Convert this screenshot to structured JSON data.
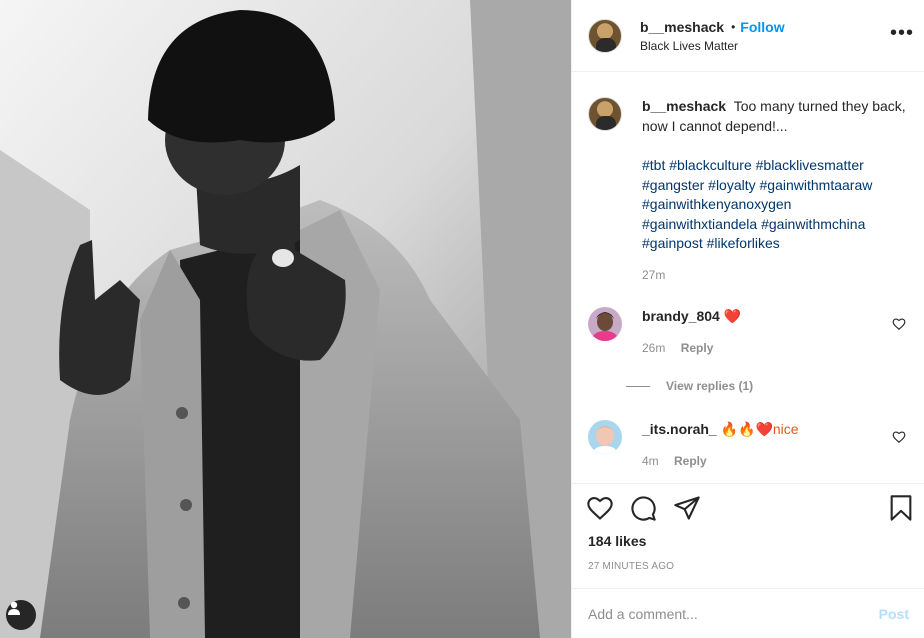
{
  "post": {
    "author": "b__meshack",
    "follow_separator": "•",
    "follow_label": "Follow",
    "location": "Black Lives Matter",
    "more_label": "•••"
  },
  "caption": {
    "author": "b__meshack",
    "text": "Too many turned they back, now I cannot depend!...",
    "hashtags": [
      "#tbt #blackculture #blacklivesmatter",
      "#gangster #loyalty #gainwithmtaaraw",
      "#gainwithkenyanoxygen",
      "#gainwithxtiandela #gainwithmchina",
      "#gainpost #likeforlikes"
    ],
    "time": "27m"
  },
  "comments": [
    {
      "author": "brandy_804",
      "text": "❤️",
      "time": "26m",
      "reply_label": "Reply",
      "view_replies": "View replies (1)",
      "avatar_icon": "user-avatar"
    },
    {
      "author": "_its.norah_",
      "text": "🔥🔥❤️nice",
      "time": "4m",
      "reply_label": "Reply",
      "avatar_icon": "user-avatar"
    }
  ],
  "actions": {
    "icons": [
      "heart-icon",
      "comment-icon",
      "share-icon",
      "bookmark-icon"
    ],
    "likes": "184 likes",
    "timestamp": "27 MINUTES AGO"
  },
  "composer": {
    "placeholder": "Add a comment...",
    "post_label": "Post"
  },
  "colors": {
    "link_blue": "#0095f6",
    "hashtag": "#00376b",
    "muted": "#8e8e8e",
    "post_disabled": "#b2dffc",
    "heart": "#e0245e"
  }
}
